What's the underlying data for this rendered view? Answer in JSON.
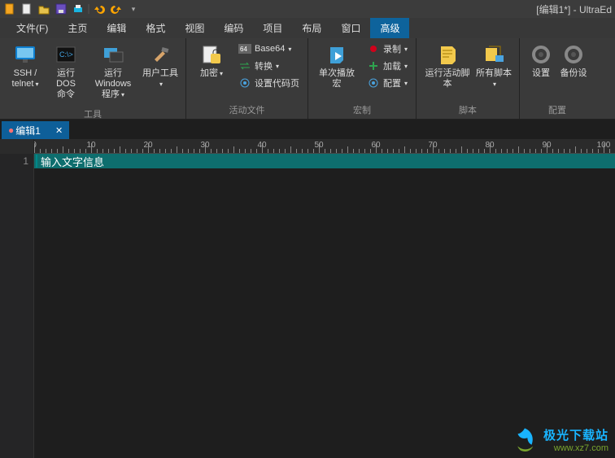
{
  "title": "[编辑1*]  -  UltraEd",
  "qat_icons": [
    "file-orange",
    "new-doc",
    "open-folder",
    "save",
    "print",
    "divider",
    "undo",
    "redo",
    "divider"
  ],
  "menubar": [
    "文件(F)",
    "主页",
    "编辑",
    "格式",
    "视图",
    "编码",
    "项目",
    "布局",
    "窗口",
    "高级"
  ],
  "menubar_active_index": 9,
  "ribbon": {
    "groups": [
      {
        "title": "工具",
        "buttons": [
          {
            "name": "ssh-telnet",
            "label": "SSH /\ntelnet",
            "caret": true,
            "icon": "monitor"
          },
          {
            "name": "run-dos",
            "label": "运行 DOS\n命令",
            "icon": "cmd"
          },
          {
            "name": "run-windows",
            "label": "运行 Windows\n程序",
            "caret": true,
            "icon": "windows-run"
          },
          {
            "name": "user-tools",
            "label": "用户工具",
            "caret": true,
            "icon": "hammer"
          }
        ]
      },
      {
        "title": "活动文件",
        "left_buttons": [
          {
            "name": "encrypt",
            "label": "加密",
            "caret": true,
            "icon": "lock"
          }
        ],
        "rows": [
          {
            "name": "base64",
            "icon": "64",
            "label": "Base64",
            "caret": true
          },
          {
            "name": "convert",
            "icon": "arrows",
            "label": "转换",
            "caret": true
          },
          {
            "name": "codepage",
            "icon": "gear",
            "label": "设置代码页"
          }
        ]
      },
      {
        "title": "宏制",
        "left_buttons": [
          {
            "name": "play-macro",
            "label": "单次播放宏",
            "icon": "scroll-play"
          }
        ],
        "rows": [
          {
            "name": "record",
            "icon": "rec",
            "label": "录制",
            "caret": true
          },
          {
            "name": "load",
            "icon": "plus",
            "label": "加载",
            "caret": true
          },
          {
            "name": "configure",
            "icon": "gear2",
            "label": "配置",
            "caret": true
          }
        ]
      },
      {
        "title": "脚本",
        "buttons": [
          {
            "name": "run-active-script",
            "label": "运行活动脚本",
            "icon": "scroll-run"
          },
          {
            "name": "all-scripts",
            "label": "所有脚本",
            "caret": true,
            "icon": "scroll-all"
          }
        ]
      },
      {
        "title": "配置",
        "buttons": [
          {
            "name": "settings",
            "label": "设置",
            "icon": "gear-big"
          },
          {
            "name": "backup",
            "label": "备份设",
            "icon": "gear-big2"
          }
        ]
      }
    ]
  },
  "doc_tab": {
    "label": "编辑1",
    "modified": true
  },
  "ruler": {
    "step": 10,
    "max": 100
  },
  "gutter_line": "1",
  "editor_text": "输入文字信息",
  "watermark": {
    "line1": "极光下载站",
    "line2": "www.xz7.com"
  }
}
